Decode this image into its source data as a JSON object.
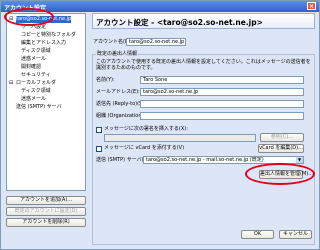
{
  "window": {
    "title": "アカウント設定"
  },
  "tree": {
    "items": [
      {
        "label": "taro@so2.so-net.ne.jp",
        "indent": 0,
        "selected": true
      },
      {
        "label": "サーバ設定",
        "indent": 1
      },
      {
        "label": "コピーと特別なフォルダ",
        "indent": 1
      },
      {
        "label": "編集とアドレス入力",
        "indent": 1
      },
      {
        "label": "ディスク領域",
        "indent": 1
      },
      {
        "label": "迷惑メール",
        "indent": 1
      },
      {
        "label": "開封確認",
        "indent": 1
      },
      {
        "label": "セキュリティ",
        "indent": 1
      },
      {
        "label": "ローカルフォルダ",
        "indent": 0
      },
      {
        "label": "ディスク領域",
        "indent": 1
      },
      {
        "label": "迷惑メール",
        "indent": 1
      },
      {
        "label": "送信 (SMTP) サーバ",
        "indent": 0
      }
    ]
  },
  "left_buttons": {
    "add": "アカウントを追加(A)...",
    "default": "既定のアカウントに設定(D)",
    "delete": "アカウントを削除(R)"
  },
  "main": {
    "heading": "アカウント設定 - <taro@so2.so-net.ne.jp>",
    "account_name_label": "アカウント名(N):",
    "account_name_value": "taro@so2.so-net.ne.jp",
    "section_title": "既定の差出人情報",
    "section_desc": "このアカウントで使用する既定の差出人情報を設定してください。これはメッセージの送信者を識別するためのものです。",
    "name_label": "名前(Y):",
    "name_value": "Taro Sone",
    "email_label": "メールアドレス(E):",
    "email_value": "taro@so2.so-net.ne.jp",
    "replyto_label": "返信先 (Reply-to)(S):",
    "replyto_value": "",
    "org_label": "組織 (Organization)(O):",
    "org_value": "",
    "signature_check": "メッセージに次の署名を挿入する(X):",
    "signature_button": "参照(C)...",
    "vcard_check": "メッセージに vCard を添付する(V)",
    "vcard_button": "vCard を編集(D)...",
    "smtp_label": "送信 (SMTP) サーバ(U):",
    "smtp_value": "taro@so2.so-net.ne.jp - mail.so-net.ne.jp (既定)",
    "manage_identities_button": "差出人情報を管理(M)..."
  },
  "footer": {
    "ok": "OK",
    "cancel": "キャンセル"
  },
  "colors": {
    "highlight": "#e4001b",
    "accent": "#316ac5"
  }
}
